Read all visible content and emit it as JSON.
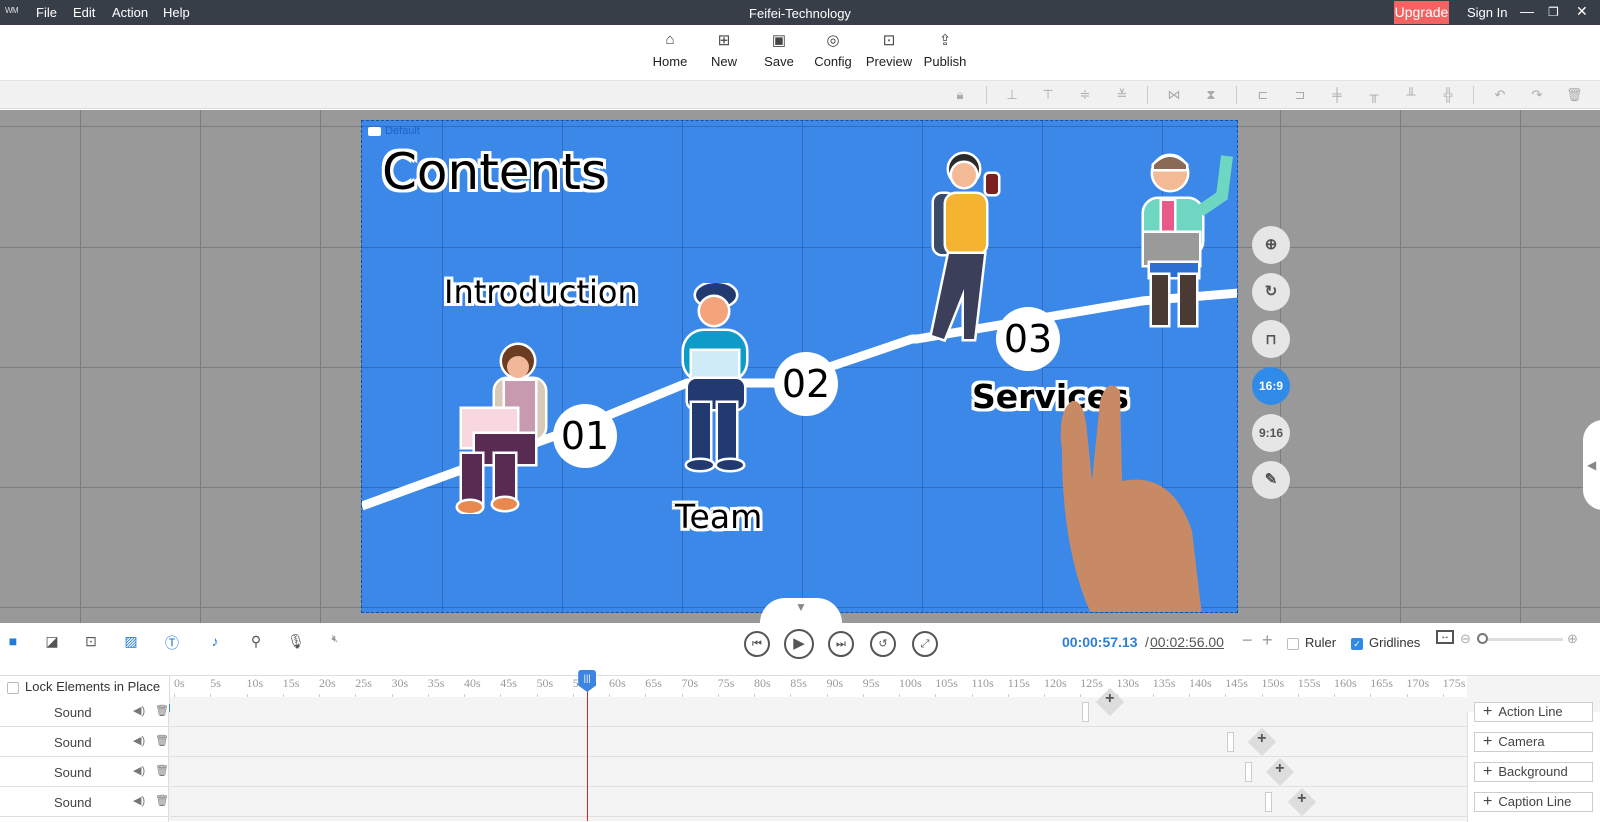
{
  "titlebar": {
    "logo": "WM",
    "menu": [
      "File",
      "Edit",
      "Action",
      "Help"
    ],
    "title": "Feifei-Technology",
    "upgrade": "Upgrade",
    "signin": "Sign In",
    "window_controls": [
      "minimize-icon",
      "restore-icon",
      "close-icon"
    ]
  },
  "toolbar": {
    "buttons": [
      {
        "label": "Home",
        "icon": "home-icon",
        "glyph": "⌂"
      },
      {
        "label": "New",
        "icon": "new-icon",
        "glyph": "⊞"
      },
      {
        "label": "Save",
        "icon": "save-icon",
        "glyph": "▣"
      },
      {
        "label": "Config",
        "icon": "config-icon",
        "glyph": "◎"
      },
      {
        "label": "Preview",
        "icon": "preview-icon",
        "glyph": "⊡"
      },
      {
        "label": "Publish",
        "icon": "publish-icon",
        "glyph": "⇪"
      }
    ]
  },
  "alignbar": {
    "icons": [
      "lock-icon",
      "align-center-vertical-icon",
      "align-top-edge-icon",
      "distribute-vertical-icon",
      "align-bottom-edge-icon",
      "flip-horizontal-icon",
      "flip-vertical-icon",
      "align-left-icon",
      "align-right-icon",
      "align-center-horizontal-icon",
      "align-top-icon",
      "align-bottom-icon",
      "distribute-horizontal-icon",
      "undo-icon",
      "redo-icon",
      "delete-icon"
    ]
  },
  "canvas": {
    "camera_label": "Default",
    "title": "Contents",
    "labels": [
      "Introduction",
      "Team",
      "Services"
    ],
    "steps": [
      "01",
      "02",
      "03"
    ],
    "background_color": "#3b88e8"
  },
  "side_tools": {
    "buttons": [
      {
        "icon": "add-camera-icon",
        "glyph": "⊕"
      },
      {
        "icon": "rotate-icon",
        "glyph": "↻"
      },
      {
        "icon": "unlock-icon",
        "glyph": "🔓"
      },
      {
        "label": "16:9",
        "active": true
      },
      {
        "label": "9:16",
        "active": false
      },
      {
        "icon": "edit-icon",
        "glyph": "✎"
      }
    ]
  },
  "bottombar": {
    "element_icons": [
      "camera-track-icon",
      "background-icon",
      "add-element-icon",
      "shape-icon",
      "text-icon",
      "music-icon",
      "role-icon",
      "microphone-icon",
      "mute-icon"
    ],
    "current_time": "00:00:57.13",
    "separator": "/",
    "total_time": "00:02:56.00",
    "ruler_label": "Ruler",
    "ruler_checked": false,
    "gridlines_label": "Gridlines",
    "gridlines_checked": true,
    "zoom_level": 0
  },
  "timeline": {
    "lock_label": "Lock Elements in Place",
    "lock_checked": false,
    "ticks": [
      "0s",
      "5s",
      "10s",
      "15s",
      "20s",
      "25s",
      "30s",
      "35s",
      "40s",
      "45s",
      "50s",
      "55s",
      "60s",
      "65s",
      "70s",
      "75s",
      "80s",
      "85s",
      "90s",
      "95s",
      "100s",
      "105s",
      "110s",
      "115s",
      "120s",
      "125s",
      "130s",
      "135s",
      "140s",
      "145s",
      "150s",
      "155s",
      "160s",
      "165s",
      "170s",
      "175s"
    ],
    "playhead_seconds": 57.13,
    "tracks": [
      {
        "name": "Sound"
      },
      {
        "name": "Sound"
      },
      {
        "name": "Sound"
      },
      {
        "name": "Sound"
      }
    ],
    "add_buttons": [
      "Action Line",
      "Camera",
      "Background",
      "Caption Line"
    ]
  }
}
